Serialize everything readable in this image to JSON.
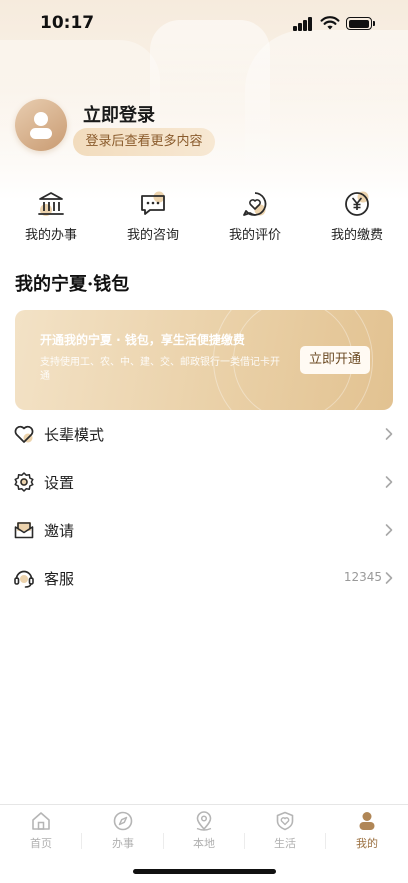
{
  "status_bar": {
    "time": "10:17"
  },
  "profile": {
    "login_title": "立即登录",
    "login_hint": "登录后查看更多内容"
  },
  "quick_actions": [
    {
      "label": "我的办事",
      "icon": "bank-icon"
    },
    {
      "label": "我的咨询",
      "icon": "chat-icon"
    },
    {
      "label": "我的评价",
      "icon": "heart-chat-icon"
    },
    {
      "label": "我的缴费",
      "icon": "yen-icon"
    }
  ],
  "wallet_section": {
    "title": "我的宁夏·钱包",
    "card_title": "开通我的宁夏 · 钱包，享生活便捷缴费",
    "card_sub": "支持使用工、农、中、建、交、邮政银行一类借记卡开通",
    "open_button": "立即开通"
  },
  "menu": [
    {
      "label": "长辈模式",
      "icon": "heart-icon",
      "value": ""
    },
    {
      "label": "设置",
      "icon": "gear-icon",
      "value": ""
    },
    {
      "label": "邀请",
      "icon": "mail-icon",
      "value": ""
    },
    {
      "label": "客服",
      "icon": "headset-icon",
      "value": "12345"
    }
  ],
  "tab_bar": [
    {
      "label": "首页",
      "icon": "home-icon",
      "active": false
    },
    {
      "label": "办事",
      "icon": "compass-icon",
      "active": false
    },
    {
      "label": "本地",
      "icon": "location-icon",
      "active": false
    },
    {
      "label": "生活",
      "icon": "shield-heart-icon",
      "active": false
    },
    {
      "label": "我的",
      "icon": "user-icon",
      "active": true
    }
  ],
  "colors": {
    "accent": "#9b7040",
    "pill_bg": "#f2dcbd",
    "card_gold": "#e9cfa5",
    "icon_gold": "#e6c592"
  }
}
